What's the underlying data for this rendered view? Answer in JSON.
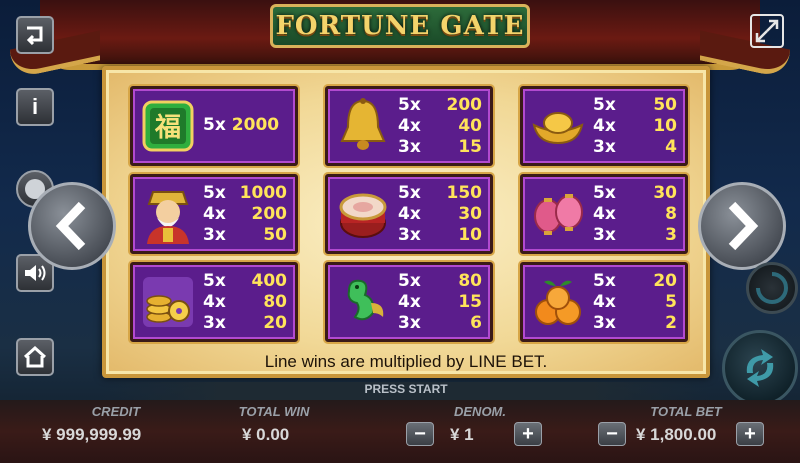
{
  "game": {
    "title": "FORTUNE GATE"
  },
  "paytable": {
    "note": "Line wins are multiplied by LINE BET.",
    "symbols": [
      {
        "icon": "fu-character-icon",
        "pays": [
          {
            "k": "5x",
            "v": "2000"
          }
        ]
      },
      {
        "icon": "golden-bell-icon",
        "pays": [
          {
            "k": "5x",
            "v": "200"
          },
          {
            "k": "4x",
            "v": "40"
          },
          {
            "k": "3x",
            "v": "15"
          }
        ]
      },
      {
        "icon": "gold-ingot-icon",
        "pays": [
          {
            "k": "5x",
            "v": "50"
          },
          {
            "k": "4x",
            "v": "10"
          },
          {
            "k": "3x",
            "v": "4"
          }
        ]
      },
      {
        "icon": "fortune-god-icon",
        "pays": [
          {
            "k": "5x",
            "v": "1000"
          },
          {
            "k": "4x",
            "v": "200"
          },
          {
            "k": "3x",
            "v": "50"
          }
        ]
      },
      {
        "icon": "drum-icon",
        "pays": [
          {
            "k": "5x",
            "v": "150"
          },
          {
            "k": "4x",
            "v": "30"
          },
          {
            "k": "3x",
            "v": "10"
          }
        ]
      },
      {
        "icon": "lanterns-icon",
        "pays": [
          {
            "k": "5x",
            "v": "30"
          },
          {
            "k": "4x",
            "v": "8"
          },
          {
            "k": "3x",
            "v": "3"
          }
        ]
      },
      {
        "icon": "coins-stack-icon",
        "pays": [
          {
            "k": "5x",
            "v": "400"
          },
          {
            "k": "4x",
            "v": "80"
          },
          {
            "k": "3x",
            "v": "20"
          }
        ]
      },
      {
        "icon": "jade-figure-icon",
        "pays": [
          {
            "k": "5x",
            "v": "80"
          },
          {
            "k": "4x",
            "v": "15"
          },
          {
            "k": "3x",
            "v": "6"
          }
        ]
      },
      {
        "icon": "oranges-icon",
        "pays": [
          {
            "k": "5x",
            "v": "20"
          },
          {
            "k": "4x",
            "v": "5"
          },
          {
            "k": "3x",
            "v": "2"
          }
        ]
      }
    ]
  },
  "footer": {
    "press_start": "PRESS START",
    "credit_label": "CREDIT",
    "credit_value": "¥ 999,999.99",
    "total_win_label": "TOTAL WIN",
    "total_win_value": "¥ 0.00",
    "denom_label": "DENOM.",
    "denom_value": "¥ 1",
    "total_bet_label": "TOTAL BET",
    "total_bet_value": "¥ 1,800.00",
    "minus": "−",
    "plus": "+"
  },
  "colors": {
    "cell_bg": "#5b1d8c",
    "pay_value": "#ffe45a",
    "title_gold": "#f3d36b"
  }
}
